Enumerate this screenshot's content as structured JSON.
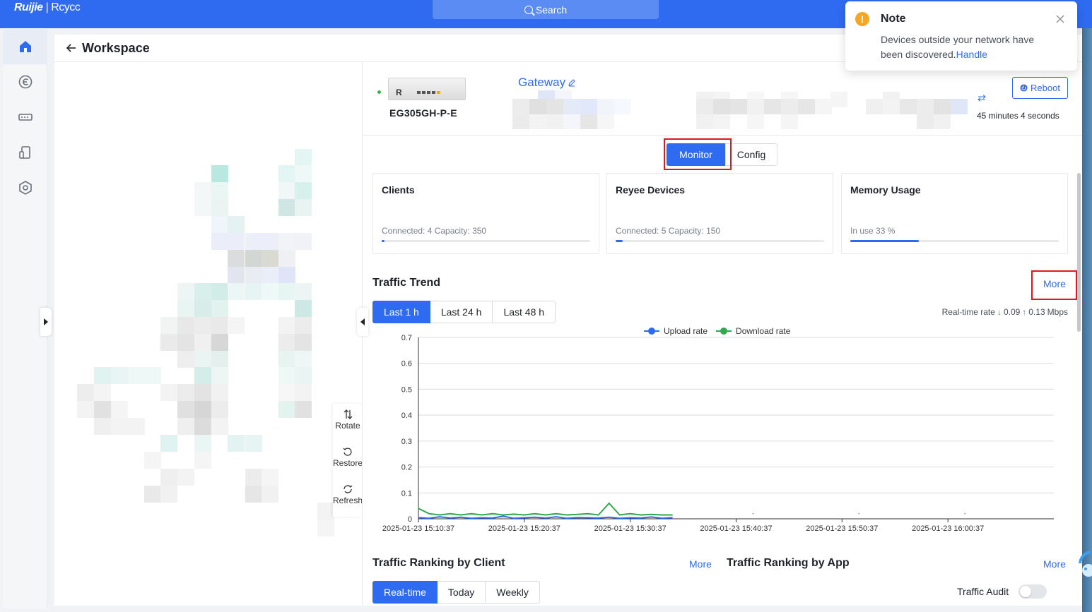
{
  "topbar": {
    "logo_brand": "Ruijie",
    "logo_separator": "|",
    "logo_sub": "Rcycc",
    "search_label": "Search"
  },
  "sidebar": {
    "items": [
      {
        "icon": "home-icon",
        "active": true
      },
      {
        "icon": "cloud-service-icon",
        "active": false
      },
      {
        "icon": "network-device-icon",
        "active": false
      },
      {
        "icon": "mobile-device-icon",
        "active": false
      },
      {
        "icon": "settings-hex-icon",
        "active": false
      }
    ]
  },
  "header": {
    "title": "Workspace"
  },
  "topology": {
    "tools": {
      "rotate": "Rotate",
      "restore": "Restore",
      "refresh": "Refresh"
    }
  },
  "device": {
    "model": "EG305GH-P-E",
    "name": "Gateway",
    "reboot_label": "Reboot",
    "uptime": "45 minutes 4 seconds",
    "status_color": "#37b34a"
  },
  "view_tabs": {
    "monitor": "Monitor",
    "config": "Config"
  },
  "stats": {
    "clients": {
      "title": "Clients",
      "sub": "Connected: 4   Capacity: 350",
      "fill": 0.011
    },
    "reyee": {
      "title": "Reyee Devices",
      "sub": "Connected: 5   Capacity: 150",
      "fill": 0.033
    },
    "memory": {
      "title": "Memory Usage",
      "sub": "In use 33 %",
      "fill": 0.33
    }
  },
  "traffic_trend": {
    "title": "Traffic Trend",
    "more": "More",
    "ranges": [
      "Last 1 h",
      "Last 24 h",
      "Last 48 h"
    ],
    "realtime_prefix": "Real-time rate",
    "download_value": "0.09",
    "upload_value": "0.13",
    "unit": "Mbps"
  },
  "chart_data": {
    "type": "line",
    "title": "",
    "xlabel": "",
    "ylabel": "",
    "ylim": [
      0,
      0.7
    ],
    "yticks": [
      "0.7",
      "0.6",
      "0.5",
      "0.4",
      "0.3",
      "0.2",
      "0.1",
      "0"
    ],
    "xticks": [
      "2025-01-23  15:10:37",
      "2025-01-23  15:20:37",
      "2025-01-23  15:30:37",
      "2025-01-23  15:40:37",
      "2025-01-23  15:50:37",
      "2025-01-23  16:00:37"
    ],
    "legend": [
      "Upload rate",
      "Download rate"
    ],
    "colors": {
      "upload": "#2f6bf0",
      "download": "#2fa84f"
    },
    "series": [
      {
        "name": "Upload rate",
        "x_minutes": [
          0,
          1,
          2,
          3,
          4,
          5,
          6,
          7,
          8,
          9,
          10,
          11,
          12,
          13,
          14,
          15,
          16,
          17,
          18,
          19,
          20,
          21,
          22,
          23,
          24,
          25,
          26,
          27,
          28,
          29,
          30,
          31,
          32,
          33,
          34,
          35,
          36,
          37,
          38,
          39,
          40,
          41,
          42,
          43,
          44,
          45,
          46,
          47,
          48,
          49,
          50,
          51,
          52,
          53,
          54,
          55,
          56,
          57,
          58,
          59
        ],
        "values": [
          0.005,
          0.002,
          0.008,
          0.003,
          0.006,
          0.002,
          0.004,
          0.003,
          0.01,
          0.002,
          0.004,
          0.006,
          0.003,
          0.008,
          0.002,
          0.005,
          0.004,
          0.003,
          0.006,
          0.002,
          0.004,
          0.003,
          0.007,
          0.002,
          0.005,
          0.003,
          0.004,
          0.006,
          0.003,
          0.008,
          0.004,
          0.002,
          0.005,
          0.003,
          0.006,
          0.004,
          0.002,
          0.005,
          0.003,
          0.007,
          0.004,
          0.003,
          0.006,
          0.002,
          0.005,
          0.004,
          0.003,
          0.006,
          0.002,
          0.004,
          0.003,
          0.005,
          0.002,
          0.004,
          0.006,
          0.003,
          0.005,
          0.004,
          0.002,
          0.003
        ]
      },
      {
        "name": "Download rate",
        "x_minutes": [
          0,
          1,
          2,
          3,
          4,
          5,
          6,
          7,
          8,
          9,
          10,
          11,
          12,
          13,
          14,
          15,
          16,
          17,
          18,
          19,
          20,
          21,
          22,
          23,
          24,
          25,
          26,
          27,
          28,
          29,
          30,
          31,
          32,
          33,
          34,
          35,
          36,
          37,
          38,
          39,
          40,
          41,
          42,
          43,
          44,
          45,
          46,
          47,
          48,
          49,
          50,
          51,
          52,
          53,
          54,
          55,
          56,
          57,
          58,
          59
        ],
        "values": [
          0.04,
          0.02,
          0.015,
          0.02,
          0.015,
          0.02,
          0.015,
          0.02,
          0.015,
          0.018,
          0.015,
          0.02,
          0.015,
          0.02,
          0.015,
          0.017,
          0.02,
          0.015,
          0.06,
          0.015,
          0.02,
          0.015,
          0.017,
          0.015,
          0.015,
          0.02,
          0.015,
          0.03,
          0.015,
          0.02,
          0.015,
          0.018,
          0.015,
          0.02,
          0.015,
          0.017,
          0.02,
          0.015,
          0.09,
          0.015,
          0.02,
          0.015,
          0.025,
          0.02,
          0.015,
          0.03,
          0.02,
          0.015,
          0.02,
          0.015,
          0.018,
          0.015,
          0.02,
          0.015,
          0.017,
          0.015,
          0.02,
          0.015,
          0.018,
          0.015
        ]
      }
    ],
    "grid": true,
    "legend_position": "top-center"
  },
  "ranking": {
    "client_title": "Traffic Ranking by Client",
    "client_more": "More",
    "app_title": "Traffic Ranking by App",
    "app_more": "More",
    "tabs": [
      "Real-time",
      "Today",
      "Weekly"
    ],
    "audit_label": "Traffic Audit",
    "audit_enabled": false
  },
  "note": {
    "title": "Note",
    "body": "Devices outside your network have been discovered.",
    "link": "Handle"
  }
}
